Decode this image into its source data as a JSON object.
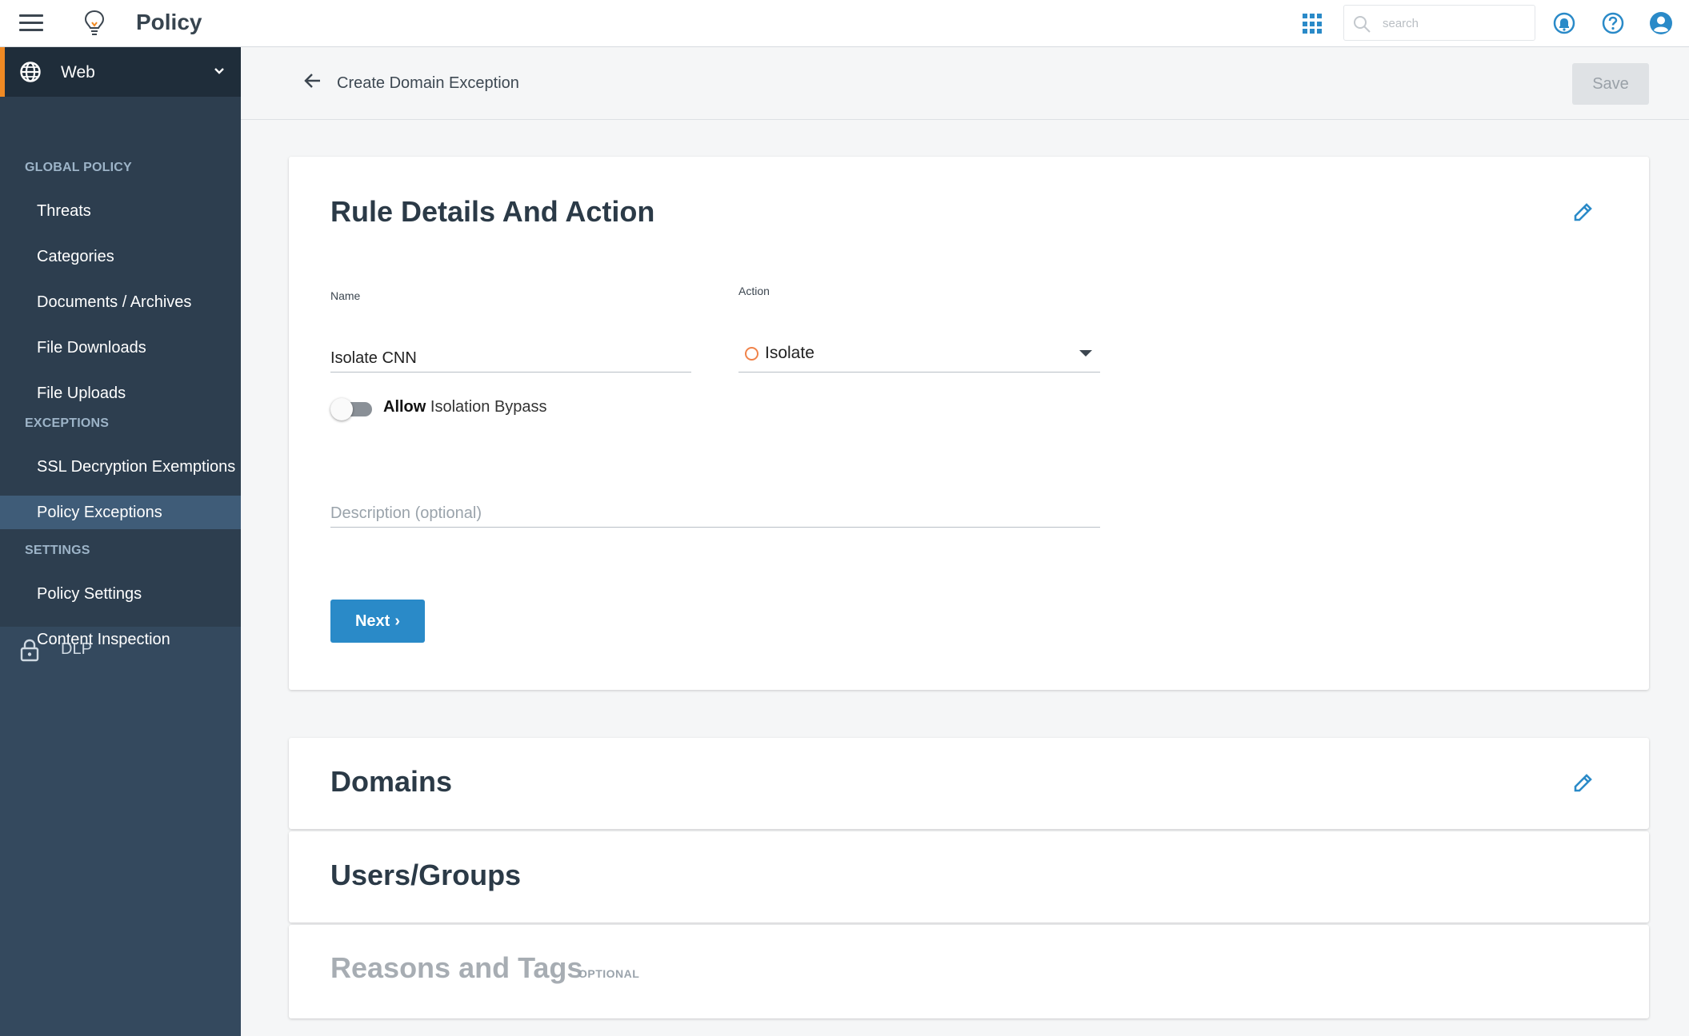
{
  "app": {
    "title": "Policy"
  },
  "search": {
    "placeholder": "search"
  },
  "sidebar": {
    "module": "Web",
    "sections": [
      {
        "label": "GLOBAL POLICY",
        "items": [
          "Threats",
          "Categories",
          "Documents / Archives",
          "File Downloads",
          "File Uploads"
        ]
      },
      {
        "label": "EXCEPTIONS",
        "items": [
          "SSL Decryption Exemptions",
          "Policy Exceptions"
        ]
      },
      {
        "label": "SETTINGS",
        "items": [
          "Policy Settings",
          "Content Inspection"
        ]
      }
    ],
    "active_item": "Policy Exceptions",
    "dlp": "DLP"
  },
  "header": {
    "title": "Create Domain Exception",
    "save_label": "Save"
  },
  "rule_card": {
    "title": "Rule Details And Action",
    "name_label": "Name",
    "name_value": "Isolate CNN",
    "action_label": "Action",
    "action_value": "Isolate",
    "toggle_bold": "Allow",
    "toggle_rest": " Isolation Bypass",
    "toggle_on": false,
    "description_placeholder": "Description (optional)",
    "next_label": "Next"
  },
  "domains_card": {
    "title": "Domains"
  },
  "users_card": {
    "title": "Users/Groups"
  },
  "reasons_card": {
    "title": "Reasons and Tags",
    "tag": "OPTIONAL"
  },
  "colors": {
    "accent": "#2a8ac8",
    "sidebar": "#34495e",
    "active_bar": "#f08a24",
    "isolate_ring": "#f0834a"
  }
}
